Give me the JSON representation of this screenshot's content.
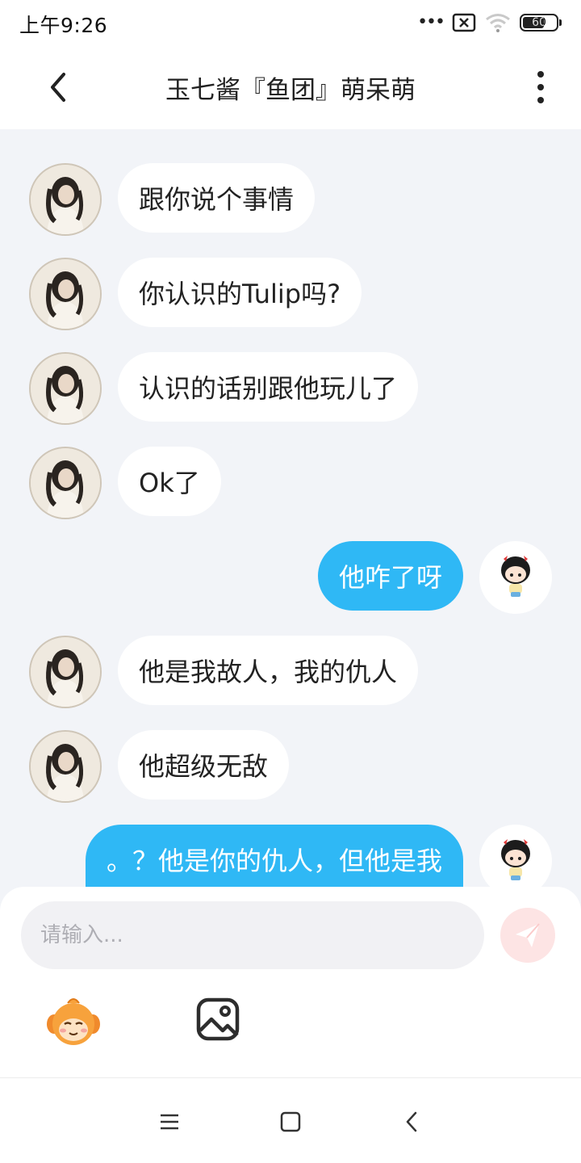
{
  "status_bar": {
    "time": "上午9:26",
    "battery": "60",
    "battery_level": 0.6
  },
  "header": {
    "title": "玉七酱『鱼团』萌呆萌"
  },
  "messages": [
    {
      "side": "in",
      "text": "跟你说个事情"
    },
    {
      "side": "in",
      "text": "你认识的Tulip吗?"
    },
    {
      "side": "in",
      "text": "认识的话别跟他玩儿了"
    },
    {
      "side": "in",
      "text": "Ok了"
    },
    {
      "side": "out",
      "text": "他咋了呀"
    },
    {
      "side": "in",
      "text": "他是我故人，我的仇人"
    },
    {
      "side": "in",
      "text": "他超级无敌"
    },
    {
      "side": "out",
      "text": "。？他是你的仇人，但他是我"
    }
  ],
  "composer": {
    "placeholder": "请输入..."
  },
  "colors": {
    "outgoing_bubble": "#2fb8f5",
    "incoming_bubble": "#ffffff",
    "background": "#f2f4f8",
    "send_button": "#fde4e4"
  },
  "icons": {
    "back": "chevron-left-icon",
    "more": "more-vertical-icon",
    "send": "paper-plane-icon",
    "emoji": "emoji-face-icon",
    "image": "image-icon",
    "nav_menu": "menu-icon",
    "nav_home": "home-square-icon",
    "nav_back": "nav-back-icon"
  }
}
